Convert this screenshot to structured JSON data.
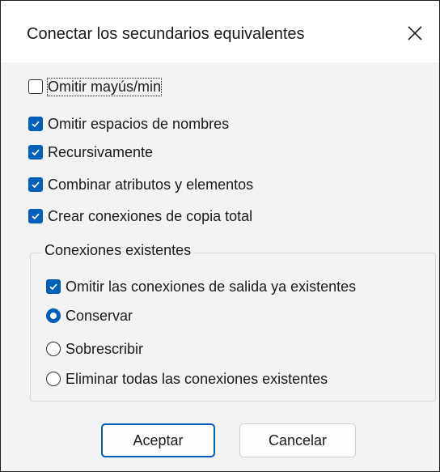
{
  "dialog": {
    "title": "Conectar los secundarios equivalentes",
    "close_icon": "close-icon"
  },
  "options": [
    {
      "label": "Omitir mayús/min",
      "checked": false,
      "focused": true
    },
    {
      "label": "Omitir espacios de nombres",
      "checked": true
    },
    {
      "label": "Recursivamente",
      "checked": true
    },
    {
      "label": "Combinar atributos y elementos",
      "checked": true
    },
    {
      "label": "Crear conexiones de copia total",
      "checked": true
    }
  ],
  "existing_connections": {
    "legend": "Conexiones existentes",
    "skip_outgoing": {
      "label": "Omitir las conexiones de salida ya existentes",
      "checked": true
    },
    "radios": [
      {
        "label": "Conservar",
        "selected": true
      },
      {
        "label": "Sobrescribir",
        "selected": false
      },
      {
        "label": "Eliminar todas las conexiones existentes",
        "selected": false
      }
    ]
  },
  "buttons": {
    "ok_label": "Aceptar",
    "cancel_label": "Cancelar"
  },
  "colors": {
    "accent": "#005fb8",
    "dialog_background": "#f3f3f3",
    "titlebar_background": "#ffffff"
  }
}
